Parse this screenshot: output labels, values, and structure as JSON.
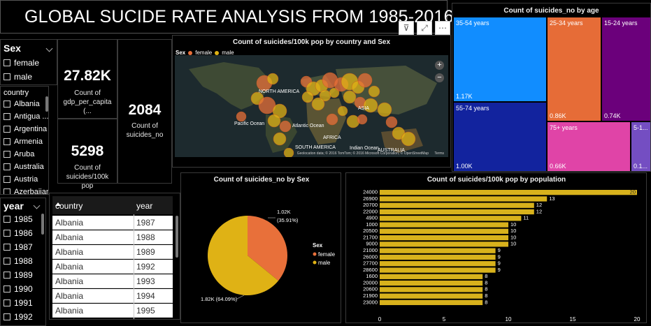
{
  "title": "GLOBAL SUCIDE RATE ANALYSIS FROM 1985-2016",
  "sex_slicer": {
    "header": "Sex",
    "options": [
      "female",
      "male"
    ]
  },
  "country_slicer": {
    "header": "country",
    "options": [
      "Albania",
      "Antigua ...",
      "Argentina",
      "Armenia",
      "Aruba",
      "Australia",
      "Austria",
      "Azerbaijan"
    ]
  },
  "year_slicer": {
    "header": "year",
    "options": [
      "1985",
      "1986",
      "1987",
      "1988",
      "1989",
      "1990",
      "1991",
      "1992"
    ]
  },
  "kpis": {
    "gdp": {
      "value": "27.82K",
      "label": "Count of gdp_per_capita (..."
    },
    "suicides_no": {
      "value": "2084",
      "label": "Count of suicides_no"
    },
    "per100k": {
      "value": "5298",
      "label": "Count of suicides/100k pop"
    }
  },
  "map": {
    "title": "Count of suicides/100k pop by country and Sex",
    "legend_title": "Sex",
    "legend": [
      "female",
      "male"
    ],
    "labels": [
      "NORTH AMERICA",
      "Pacific Ocean",
      "Atlantic Ocean",
      "AFRICA",
      "SOUTH AMERICA",
      "Indian Ocean",
      "AUSTRALIA",
      "ASIA"
    ],
    "attribution": "Geolocation data; © 2016 TomTom; © 2016 Microsoft Corporation; © OpenStreetMap",
    "terms": "Terms"
  },
  "colors": {
    "female": "#e8703a",
    "male": "#dfb215",
    "bar": "#d8b21c"
  },
  "table": {
    "headers": [
      "country",
      "year"
    ],
    "rows": [
      [
        "Albania",
        "1987"
      ],
      [
        "Albania",
        "1988"
      ],
      [
        "Albania",
        "1989"
      ],
      [
        "Albania",
        "1992"
      ],
      [
        "Albania",
        "1993"
      ],
      [
        "Albania",
        "1994"
      ],
      [
        "Albania",
        "1995"
      ]
    ]
  },
  "treemap": {
    "title": "Count of suicides_no by age",
    "cells": [
      {
        "label": "35-54 years",
        "value": "1.17K",
        "color": "#118dff"
      },
      {
        "label": "25-34 years",
        "value": "0.86K",
        "color": "#e66c37"
      },
      {
        "label": "15-24 years",
        "value": "0.74K",
        "color": "#6b007b"
      },
      {
        "label": "55-74 years",
        "value": "1.00K",
        "color": "#12239e"
      },
      {
        "label": "75+ years",
        "value": "0.66K",
        "color": "#e044a7"
      },
      {
        "label": "5-1...",
        "value": "0.1...",
        "color": "#744ec2"
      }
    ]
  },
  "chart_data": [
    {
      "type": "pie",
      "title": "Count of suicides_no by Sex",
      "legend_title": "Sex",
      "categories": [
        "female",
        "male"
      ],
      "values": [
        1020,
        1820
      ],
      "labels": [
        "1.02K\n(35.91%)",
        "1.82K (64.09%)"
      ],
      "percent": [
        35.91,
        64.09
      ]
    },
    {
      "type": "bar",
      "orientation": "horizontal",
      "title": "Count of suicides/100k pop by population",
      "categories": [
        "24000",
        "26900",
        "20700",
        "22000",
        "4900",
        "1000",
        "20500",
        "21700",
        "9000",
        "21000",
        "26000",
        "27700",
        "28600",
        "1600",
        "20000",
        "20600",
        "21900",
        "23000"
      ],
      "values": [
        20,
        13,
        12,
        12,
        11,
        10,
        10,
        10,
        10,
        9,
        9,
        9,
        9,
        8,
        8,
        8,
        8,
        8
      ],
      "xlim": [
        0,
        20
      ],
      "xticks": [
        "0",
        "5",
        "10",
        "15",
        "20"
      ]
    }
  ]
}
